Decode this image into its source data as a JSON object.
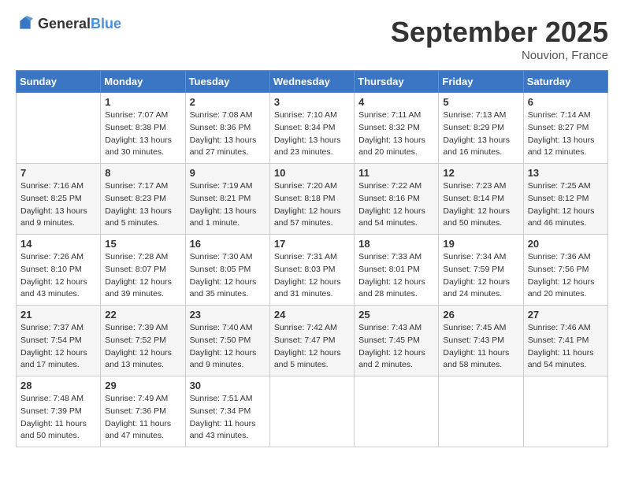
{
  "header": {
    "logo_general": "General",
    "logo_blue": "Blue",
    "month_year": "September 2025",
    "location": "Nouvion, France"
  },
  "days_of_week": [
    "Sunday",
    "Monday",
    "Tuesday",
    "Wednesday",
    "Thursday",
    "Friday",
    "Saturday"
  ],
  "weeks": [
    [
      {
        "num": "",
        "info": ""
      },
      {
        "num": "1",
        "info": "Sunrise: 7:07 AM\nSunset: 8:38 PM\nDaylight: 13 hours\nand 30 minutes."
      },
      {
        "num": "2",
        "info": "Sunrise: 7:08 AM\nSunset: 8:36 PM\nDaylight: 13 hours\nand 27 minutes."
      },
      {
        "num": "3",
        "info": "Sunrise: 7:10 AM\nSunset: 8:34 PM\nDaylight: 13 hours\nand 23 minutes."
      },
      {
        "num": "4",
        "info": "Sunrise: 7:11 AM\nSunset: 8:32 PM\nDaylight: 13 hours\nand 20 minutes."
      },
      {
        "num": "5",
        "info": "Sunrise: 7:13 AM\nSunset: 8:29 PM\nDaylight: 13 hours\nand 16 minutes."
      },
      {
        "num": "6",
        "info": "Sunrise: 7:14 AM\nSunset: 8:27 PM\nDaylight: 13 hours\nand 12 minutes."
      }
    ],
    [
      {
        "num": "7",
        "info": "Sunrise: 7:16 AM\nSunset: 8:25 PM\nDaylight: 13 hours\nand 9 minutes."
      },
      {
        "num": "8",
        "info": "Sunrise: 7:17 AM\nSunset: 8:23 PM\nDaylight: 13 hours\nand 5 minutes."
      },
      {
        "num": "9",
        "info": "Sunrise: 7:19 AM\nSunset: 8:21 PM\nDaylight: 13 hours\nand 1 minute."
      },
      {
        "num": "10",
        "info": "Sunrise: 7:20 AM\nSunset: 8:18 PM\nDaylight: 12 hours\nand 57 minutes."
      },
      {
        "num": "11",
        "info": "Sunrise: 7:22 AM\nSunset: 8:16 PM\nDaylight: 12 hours\nand 54 minutes."
      },
      {
        "num": "12",
        "info": "Sunrise: 7:23 AM\nSunset: 8:14 PM\nDaylight: 12 hours\nand 50 minutes."
      },
      {
        "num": "13",
        "info": "Sunrise: 7:25 AM\nSunset: 8:12 PM\nDaylight: 12 hours\nand 46 minutes."
      }
    ],
    [
      {
        "num": "14",
        "info": "Sunrise: 7:26 AM\nSunset: 8:10 PM\nDaylight: 12 hours\nand 43 minutes."
      },
      {
        "num": "15",
        "info": "Sunrise: 7:28 AM\nSunset: 8:07 PM\nDaylight: 12 hours\nand 39 minutes."
      },
      {
        "num": "16",
        "info": "Sunrise: 7:30 AM\nSunset: 8:05 PM\nDaylight: 12 hours\nand 35 minutes."
      },
      {
        "num": "17",
        "info": "Sunrise: 7:31 AM\nSunset: 8:03 PM\nDaylight: 12 hours\nand 31 minutes."
      },
      {
        "num": "18",
        "info": "Sunrise: 7:33 AM\nSunset: 8:01 PM\nDaylight: 12 hours\nand 28 minutes."
      },
      {
        "num": "19",
        "info": "Sunrise: 7:34 AM\nSunset: 7:59 PM\nDaylight: 12 hours\nand 24 minutes."
      },
      {
        "num": "20",
        "info": "Sunrise: 7:36 AM\nSunset: 7:56 PM\nDaylight: 12 hours\nand 20 minutes."
      }
    ],
    [
      {
        "num": "21",
        "info": "Sunrise: 7:37 AM\nSunset: 7:54 PM\nDaylight: 12 hours\nand 17 minutes."
      },
      {
        "num": "22",
        "info": "Sunrise: 7:39 AM\nSunset: 7:52 PM\nDaylight: 12 hours\nand 13 minutes."
      },
      {
        "num": "23",
        "info": "Sunrise: 7:40 AM\nSunset: 7:50 PM\nDaylight: 12 hours\nand 9 minutes."
      },
      {
        "num": "24",
        "info": "Sunrise: 7:42 AM\nSunset: 7:47 PM\nDaylight: 12 hours\nand 5 minutes."
      },
      {
        "num": "25",
        "info": "Sunrise: 7:43 AM\nSunset: 7:45 PM\nDaylight: 12 hours\nand 2 minutes."
      },
      {
        "num": "26",
        "info": "Sunrise: 7:45 AM\nSunset: 7:43 PM\nDaylight: 11 hours\nand 58 minutes."
      },
      {
        "num": "27",
        "info": "Sunrise: 7:46 AM\nSunset: 7:41 PM\nDaylight: 11 hours\nand 54 minutes."
      }
    ],
    [
      {
        "num": "28",
        "info": "Sunrise: 7:48 AM\nSunset: 7:39 PM\nDaylight: 11 hours\nand 50 minutes."
      },
      {
        "num": "29",
        "info": "Sunrise: 7:49 AM\nSunset: 7:36 PM\nDaylight: 11 hours\nand 47 minutes."
      },
      {
        "num": "30",
        "info": "Sunrise: 7:51 AM\nSunset: 7:34 PM\nDaylight: 11 hours\nand 43 minutes."
      },
      {
        "num": "",
        "info": ""
      },
      {
        "num": "",
        "info": ""
      },
      {
        "num": "",
        "info": ""
      },
      {
        "num": "",
        "info": ""
      }
    ]
  ]
}
